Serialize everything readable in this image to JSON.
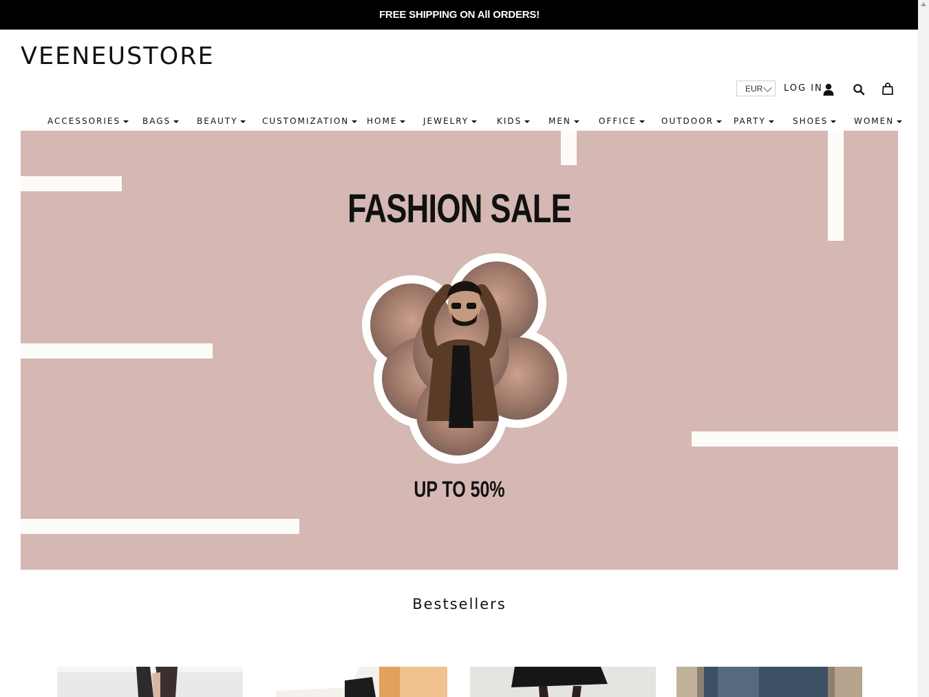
{
  "announcement": "FREE SHIPPING ON All ORDERS!",
  "logo": "VEENEUSTORE",
  "header": {
    "currency": "EUR",
    "login_label": "LOG IN",
    "icons": [
      "user-icon",
      "search-icon",
      "cart-icon"
    ]
  },
  "nav": [
    {
      "label": "ACCESSORIES"
    },
    {
      "label": "BAGS"
    },
    {
      "label": "BEAUTY"
    },
    {
      "label": "CUSTOMIZATION"
    },
    {
      "label": "HOME"
    },
    {
      "label": "JEWELRY"
    },
    {
      "label": "KIDS"
    },
    {
      "label": "MEN"
    },
    {
      "label": "OFFICE"
    },
    {
      "label": "OUTDOOR"
    },
    {
      "label": "PARTY"
    },
    {
      "label": "SHOES"
    },
    {
      "label": "WOMEN"
    }
  ],
  "hero": {
    "title": "FASHION SALE",
    "subtitle": "UP TO 50%",
    "background": "#d5b8b3"
  },
  "bestsellers": {
    "title": "Bestsellers"
  }
}
